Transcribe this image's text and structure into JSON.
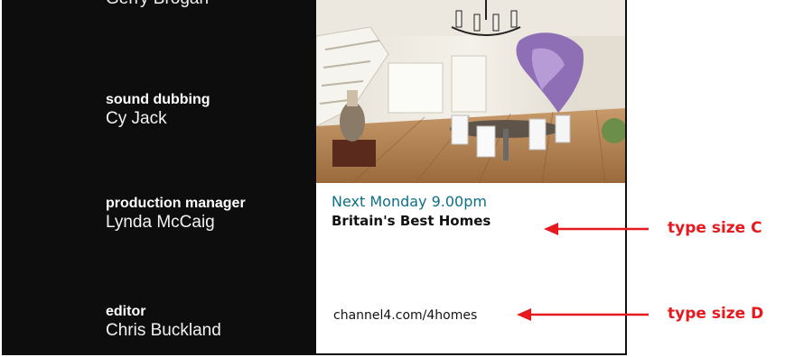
{
  "credits": {
    "cut_name": "Gerry Brogan",
    "items": [
      {
        "role": "sound dubbing",
        "name": "Cy Jack"
      },
      {
        "role": "production manager",
        "name": "Lynda McCaig"
      },
      {
        "role": "editor",
        "name": "Chris Buckland"
      }
    ]
  },
  "promo": {
    "time": "Next Monday 9.00pm",
    "title": "Britain's Best Homes",
    "url": "channel4.com/4homes"
  },
  "annotations": {
    "c_label": "type size C",
    "d_label": "type size D",
    "color": "#e5191e"
  },
  "colors": {
    "credits_bg": "#0d0d0d",
    "promo_accent": "#0e6f86"
  }
}
